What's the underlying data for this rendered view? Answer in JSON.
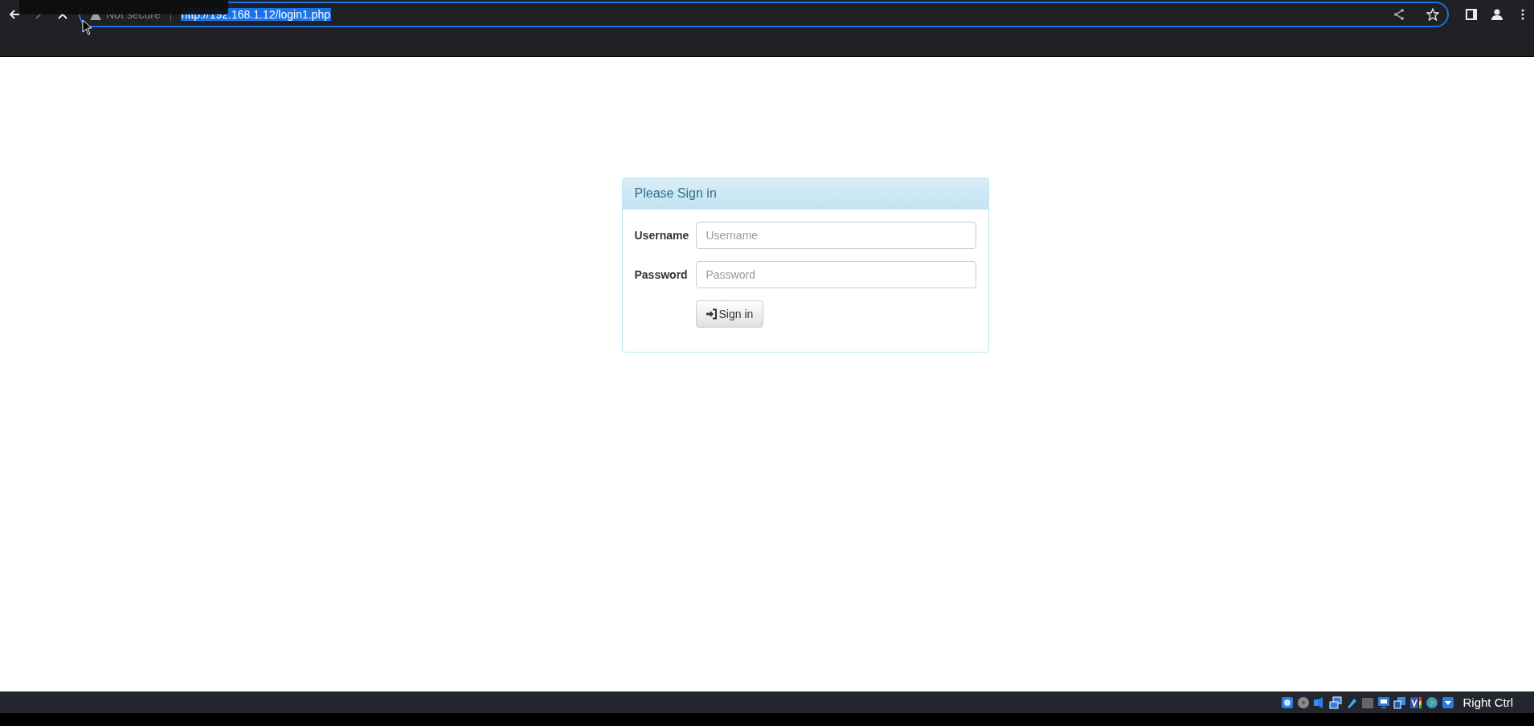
{
  "browser": {
    "security": "Not secure",
    "url": "http://192.168.1.12/login1.php",
    "url_selected": true
  },
  "login": {
    "title": "Please Sign in",
    "fields": [
      {
        "label": "Username",
        "placeholder": "Username"
      },
      {
        "label": "Password",
        "placeholder": "Password"
      }
    ],
    "button": "Sign in"
  },
  "status_bar": {
    "host_key": "Right Ctrl"
  }
}
